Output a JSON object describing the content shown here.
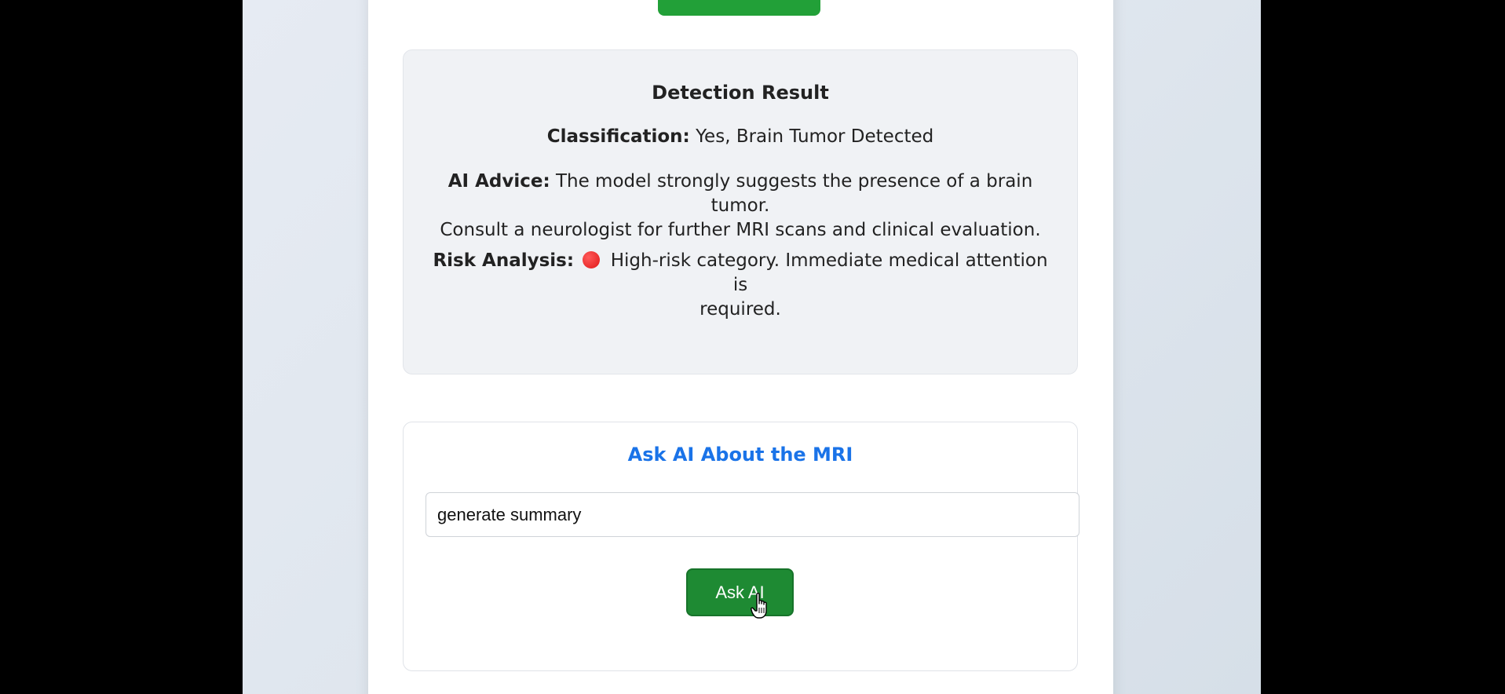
{
  "result": {
    "title": "Detection Result",
    "classification_label": "Classification:",
    "classification_value": "Yes, Brain Tumor Detected",
    "advice_label": "AI Advice:",
    "advice_line1": "The model strongly suggests the presence of a brain tumor.",
    "advice_line2": "Consult a neurologist for further MRI scans and clinical evaluation.",
    "risk_label": "Risk Analysis:",
    "risk_icon": "red-circle-icon",
    "risk_line1": "High-risk category. Immediate medical attention is",
    "risk_line2": "required."
  },
  "ask": {
    "title": "Ask AI About the MRI",
    "input_value": "generate summary",
    "button_label": "Ask AI"
  },
  "colors": {
    "accent_blue": "#1a73e8",
    "button_green": "#1e8a33",
    "risk_red": "#e01818"
  }
}
